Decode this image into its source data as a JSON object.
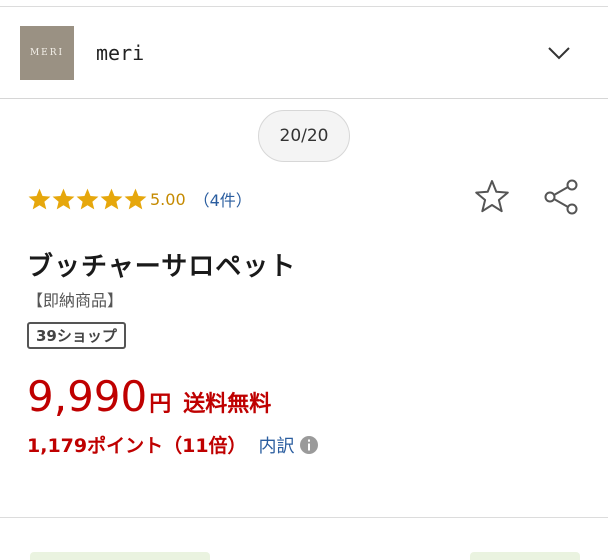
{
  "shop": {
    "logo_text": "MERI",
    "name": "meri",
    "expand_icon": "chevron-down-icon"
  },
  "gallery": {
    "counter": "20/20"
  },
  "rating": {
    "stars": 5,
    "score": "5.00",
    "count": "（4件）",
    "star_color": "#e6a70c"
  },
  "actions": {
    "favorite_icon": "star-outline-icon",
    "share_icon": "share-icon"
  },
  "product": {
    "title": "ブッチャーサロペット",
    "tag": "【即納商品】",
    "badge": "39ショップ"
  },
  "price": {
    "amount": "9,990",
    "unit": "円",
    "shipping": "送料無料",
    "color": "#bf0000"
  },
  "points": {
    "text": "1,179ポイント（11倍）",
    "breakdown_link": "内訳",
    "info_icon": "info-icon"
  }
}
